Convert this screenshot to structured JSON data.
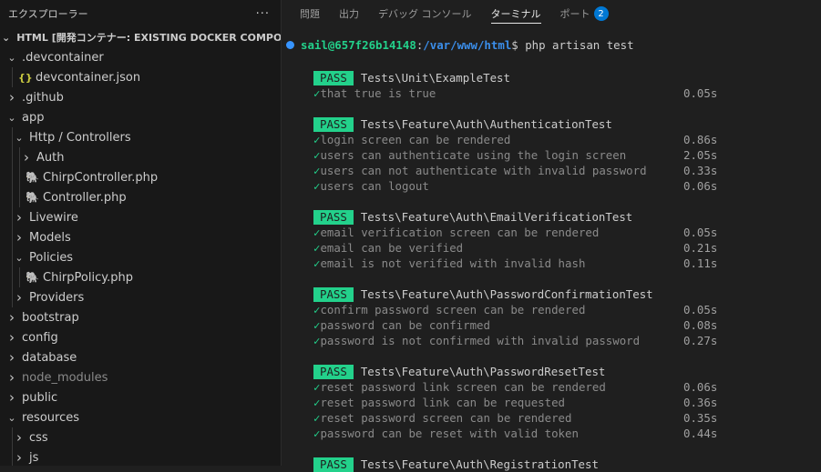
{
  "explorer": {
    "title": "エクスプローラー",
    "more_label": "···",
    "workspace": "HTML [開発コンテナー: EXISTING DOCKER COMPOSE (EXT...",
    "tree": [
      {
        "label": ".devcontainer",
        "type": "folder-open",
        "depth": 0
      },
      {
        "label": "devcontainer.json",
        "type": "json",
        "depth": 1
      },
      {
        "label": ".github",
        "type": "folder",
        "depth": 0
      },
      {
        "label": "app",
        "type": "folder-open",
        "depth": 0
      },
      {
        "label": "Http / Controllers",
        "type": "folder-open",
        "depth": 1
      },
      {
        "label": "Auth",
        "type": "folder",
        "depth": 2
      },
      {
        "label": "ChirpController.php",
        "type": "php",
        "depth": 2
      },
      {
        "label": "Controller.php",
        "type": "php",
        "depth": 2
      },
      {
        "label": "Livewire",
        "type": "folder",
        "depth": 1
      },
      {
        "label": "Models",
        "type": "folder",
        "depth": 1
      },
      {
        "label": "Policies",
        "type": "folder-open",
        "depth": 1
      },
      {
        "label": "ChirpPolicy.php",
        "type": "php",
        "depth": 2
      },
      {
        "label": "Providers",
        "type": "folder",
        "depth": 1
      },
      {
        "label": "bootstrap",
        "type": "folder",
        "depth": 0
      },
      {
        "label": "config",
        "type": "folder",
        "depth": 0
      },
      {
        "label": "database",
        "type": "folder",
        "depth": 0
      },
      {
        "label": "node_modules",
        "type": "folder-dim",
        "depth": 0
      },
      {
        "label": "public",
        "type": "folder",
        "depth": 0
      },
      {
        "label": "resources",
        "type": "folder-open",
        "depth": 0
      },
      {
        "label": "css",
        "type": "folder",
        "depth": 1
      },
      {
        "label": "js",
        "type": "folder",
        "depth": 1
      }
    ]
  },
  "panel": {
    "tabs": [
      {
        "label": "問題",
        "active": false
      },
      {
        "label": "出力",
        "active": false
      },
      {
        "label": "デバッグ コンソール",
        "active": false
      },
      {
        "label": "ターミナル",
        "active": true
      },
      {
        "label": "ポート",
        "active": false,
        "badge": "2"
      }
    ]
  },
  "terminal": {
    "prompt_user": "sail@657f26b14148",
    "prompt_sep": ":",
    "prompt_path": "/var/www/html",
    "prompt_symbol": "$",
    "command": " php artisan test",
    "pass_label": "PASS",
    "check_mark": "✓",
    "suites": [
      {
        "name": "Tests\\Unit\\ExampleTest",
        "tests": [
          {
            "name": "that true is true",
            "time": "0.05s"
          }
        ]
      },
      {
        "name": "Tests\\Feature\\Auth\\AuthenticationTest",
        "tests": [
          {
            "name": "login screen can be rendered",
            "time": "0.86s"
          },
          {
            "name": "users can authenticate using the login screen",
            "time": "2.05s"
          },
          {
            "name": "users can not authenticate with invalid password",
            "time": "0.33s"
          },
          {
            "name": "users can logout",
            "time": "0.06s"
          }
        ]
      },
      {
        "name": "Tests\\Feature\\Auth\\EmailVerificationTest",
        "tests": [
          {
            "name": "email verification screen can be rendered",
            "time": "0.05s"
          },
          {
            "name": "email can be verified",
            "time": "0.21s"
          },
          {
            "name": "email is not verified with invalid hash",
            "time": "0.11s"
          }
        ]
      },
      {
        "name": "Tests\\Feature\\Auth\\PasswordConfirmationTest",
        "tests": [
          {
            "name": "confirm password screen can be rendered",
            "time": "0.05s"
          },
          {
            "name": "password can be confirmed",
            "time": "0.08s"
          },
          {
            "name": "password is not confirmed with invalid password",
            "time": "0.27s"
          }
        ]
      },
      {
        "name": "Tests\\Feature\\Auth\\PasswordResetTest",
        "tests": [
          {
            "name": "reset password link screen can be rendered",
            "time": "0.06s"
          },
          {
            "name": "reset password link can be requested",
            "time": "0.36s"
          },
          {
            "name": "reset password screen can be rendered",
            "time": "0.35s"
          },
          {
            "name": "password can be reset with valid token",
            "time": "0.44s"
          }
        ]
      },
      {
        "name": "Tests\\Feature\\Auth\\RegistrationTest",
        "tests": []
      }
    ]
  }
}
